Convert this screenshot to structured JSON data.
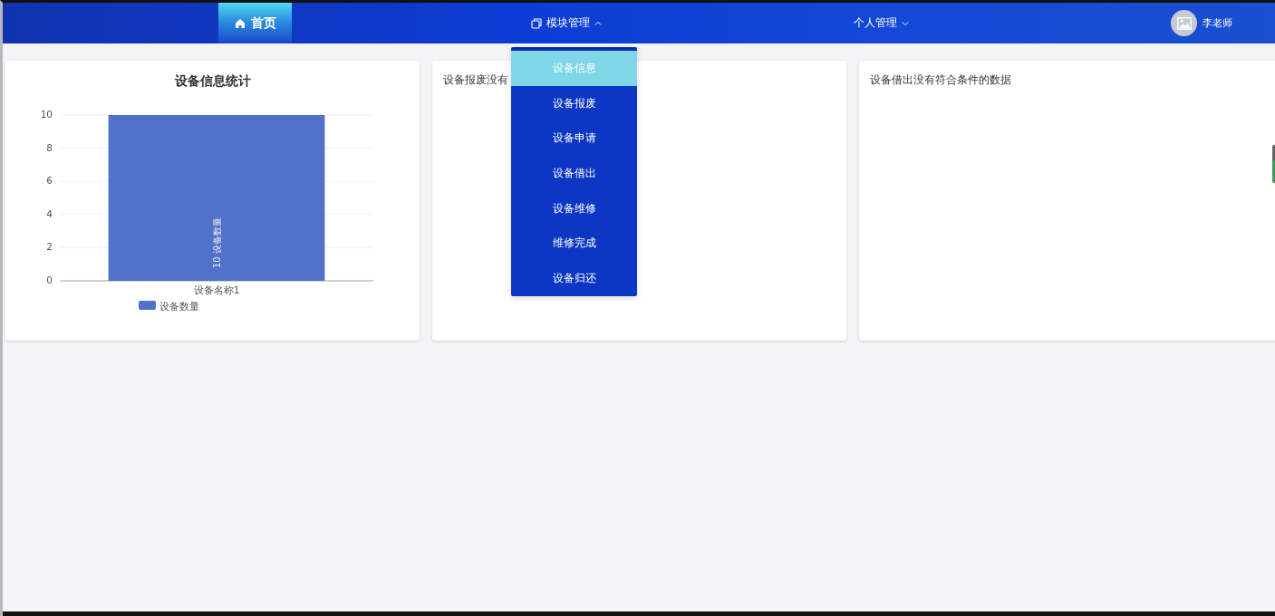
{
  "nav": {
    "home": {
      "label": "首页",
      "selected": true
    },
    "menus": [
      {
        "label": "模块管理",
        "expanded": true
      },
      {
        "label": "个人管理",
        "expanded": false
      }
    ],
    "user": {
      "name": "李老师"
    }
  },
  "dropdown": {
    "items": [
      {
        "label": "设备信息",
        "selected": true
      },
      {
        "label": "设备报废",
        "selected": false
      },
      {
        "label": "设备申请",
        "selected": false
      },
      {
        "label": "设备借出",
        "selected": false
      },
      {
        "label": "设备维修",
        "selected": false
      },
      {
        "label": "维修完成",
        "selected": false
      },
      {
        "label": "设备归还",
        "selected": false
      }
    ]
  },
  "cards": [
    {
      "kind": "chart",
      "title": "设备信息统计",
      "chart_data": {
        "type": "bar",
        "categories": [
          "设备名称1"
        ],
        "series": [
          {
            "name": "设备数量",
            "color": "#5272c9",
            "values": [
              10
            ]
          }
        ],
        "ylim": [
          0,
          10
        ],
        "yticks": [
          0,
          2,
          4,
          6,
          8,
          10
        ],
        "grid": true,
        "value_labels": [
          "10 设备数量"
        ]
      }
    },
    {
      "kind": "message",
      "text": "设备报废没有"
    },
    {
      "kind": "message",
      "text": "设备借出没有符合条件的数据"
    }
  ]
}
